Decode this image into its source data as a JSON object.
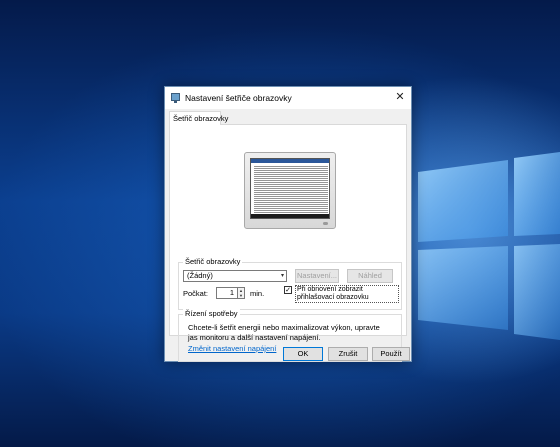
{
  "dialog": {
    "title": "Nastavení šetřiče obrazovky",
    "tab_label": "Šetřič obrazovky"
  },
  "screensaver": {
    "group_label": "Šetřič obrazovky",
    "selected": "(Žádný)",
    "settings_button": "Nastavení...",
    "preview_button": "Náhled",
    "wait_label": "Počkat:",
    "wait_value": "1",
    "unit": "min.",
    "resume_checkbox_checked": true,
    "resume_label": "Při obnovení zobrazit přihlašovací obrazovku"
  },
  "power": {
    "group_label": "Řízení spotřeby",
    "description": "Chcete-li šetřit energii nebo maximalizovat výkon, upravte jas monitoru a další nastavení napájení.",
    "link": "Změnit nastavení napájení"
  },
  "buttons": {
    "ok": "OK",
    "cancel": "Zrušit",
    "apply": "Použít"
  },
  "icons": {
    "close": "✕",
    "dropdown": "▾",
    "spin_up": "▲",
    "spin_down": "▼",
    "check": "✓"
  }
}
